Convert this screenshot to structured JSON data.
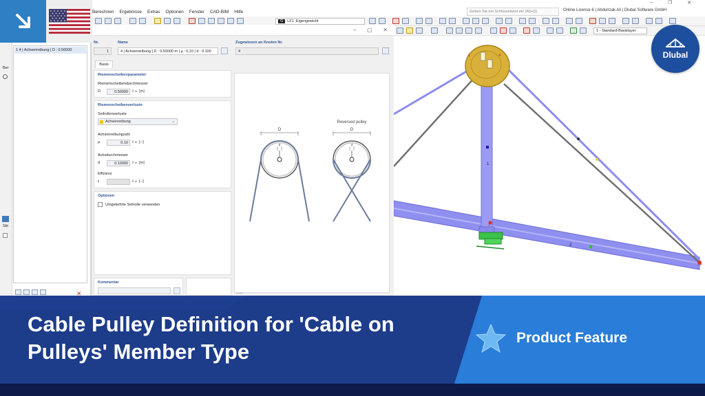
{
  "menu": {
    "items": [
      "Berechnen",
      "Ergebnisse",
      "Extras",
      "Optionen",
      "Fenster",
      "CAD-BIM",
      "Hilfe"
    ],
    "search_placeholder": "Geben Sie ein Schlüsselwort ein (Alt+Q)",
    "license": "Online License 6 | Abdulrzak Ali | Dlubal Software GmbH"
  },
  "toolbar": {
    "load_case_code": "G",
    "load_case_id": "LF1",
    "load_case_name": "Eigengewicht",
    "layer": "1 - Standard-Basislayer"
  },
  "left_panel": {
    "list_item": "1  4 | Achsenreibung | D : 0.50000",
    "strip_labels": [
      "Ber",
      "Skt"
    ]
  },
  "dialog": {
    "no_label": "Nr.",
    "no_value": "1",
    "name_label": "Name",
    "name_value": "4 | Achsenreibung | D : 0.50000 m | µ : 0.10 | d : 0.100",
    "assigned_label": "Zugewiesen an Knoten Nr.",
    "assigned_value": "4",
    "tab_basis": "Basis",
    "pulley_params": {
      "title": "Riemenscheibenparameter",
      "diameter_label": "Riemenscheibendurchmesser",
      "d_symbol": "D",
      "d_value": "0.50000",
      "d_unit": "[m]"
    },
    "pulley_losses": {
      "title": "Riemenscheibenverluste",
      "losses_label": "Seilrollenverluste",
      "losses_value": "Achsenreibung",
      "friction_label": "Achsenreibungzahl",
      "mu_symbol": "µ",
      "mu_value": "0.10",
      "mu_unit": "[--]",
      "axle_label": "Achsdurchmesser",
      "axle_symbol": "d",
      "axle_value": "0.10000",
      "axle_unit": "[m]",
      "efficiency_label": "Effizienz",
      "efficiency_symbol": "ε",
      "efficiency_value": "",
      "efficiency_unit": "[--]"
    },
    "options": {
      "title": "Optionen",
      "reverse_label": "Umgekehrte Seilrolle verwenden",
      "reverse_checked": false
    },
    "comment_label": "Kommentar",
    "figure": {
      "reversed_caption": "Reversed pulley",
      "dim_D": "D",
      "dim_d": "d"
    }
  },
  "view3d": {
    "member_labels": [
      "1",
      "2"
    ],
    "node_labels": [
      "1",
      "2",
      "3",
      "4"
    ],
    "colors": {
      "member": "#8c8cf0",
      "cable": "#6e6e6e",
      "pulley": "#d9b13a",
      "support": "#3cc24a"
    }
  },
  "logo": {
    "brand": "Dlubal",
    "icon": "bridge-logo-icon"
  },
  "banner": {
    "title": "Cable Pulley Definition for 'Cable on Pulleys' Member Type",
    "feature_label": "Product Feature",
    "feature_icon": "star-icon",
    "flag_icon": "us-flag-icon",
    "arrow_icon": "arrow-down-right-icon",
    "colors": {
      "banner": "#1d3c8a",
      "accent": "#2a7dd8",
      "star": "#6fb9f2"
    }
  }
}
